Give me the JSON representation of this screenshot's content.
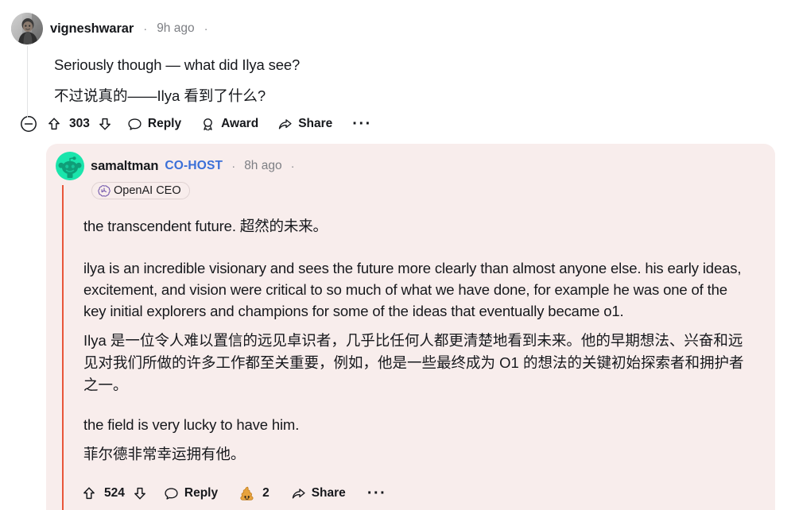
{
  "root_comment": {
    "author": "vigneshwarar",
    "timestamp": "9h ago",
    "separator": "·",
    "avatar_icon": "user-photo-avatar",
    "text_en": "Seriously though — what did Ilya see?",
    "text_zh": "不过说真的——Ilya 看到了什么?",
    "actions": {
      "collapse_icon": "minus-circle-icon",
      "upvote_icon": "upvote-arrow-icon",
      "score": "303",
      "downvote_icon": "downvote-arrow-icon",
      "reply_icon": "speech-bubble-icon",
      "reply_label": "Reply",
      "award_icon": "award-medal-icon",
      "award_label": "Award",
      "share_icon": "share-arrow-icon",
      "share_label": "Share",
      "overflow_label": "···"
    }
  },
  "reply_comment": {
    "author": "samaltman",
    "badge": "CO-HOST",
    "timestamp": "8h ago",
    "separator": "·",
    "avatar_icon": "reddit-snoo-avatar",
    "flair": {
      "icon": "openai-logo-icon",
      "label": "OpenAI CEO"
    },
    "paragraphs": [
      {
        "type": "en",
        "text": "the transcendent future.  超然的未来。"
      },
      {
        "type": "en",
        "text": "ilya is an incredible visionary and sees the future more clearly than almost anyone else. his early ideas, excitement, and vision were critical to so much of what we have done, for example he was one of the key initial explorers and champions for some of the ideas that eventually became o1."
      },
      {
        "type": "zh",
        "text": "Ilya 是一位令人难以置信的远见卓识者，几乎比任何人都更清楚地看到未来。他的早期想法、兴奋和远见对我们所做的许多工作都至关重要，例如，他是一些最终成为 O1 的想法的关键初始探索者和拥护者之一。"
      },
      {
        "type": "en",
        "text": "the field is very lucky to have him."
      },
      {
        "type": "zh",
        "text": "菲尔德非常幸运拥有他。"
      }
    ],
    "actions": {
      "upvote_icon": "upvote-arrow-icon",
      "score": "524",
      "downvote_icon": "downvote-arrow-icon",
      "reply_icon": "speech-bubble-icon",
      "reply_label": "Reply",
      "award_emoji": "🦴",
      "award_count": "2",
      "share_icon": "share-arrow-icon",
      "share_label": "Share",
      "overflow_label": "···"
    }
  },
  "colors": {
    "reply_background": "#f8edec",
    "thread_line": "#e8563a",
    "cohost_blue": "#3a6fd8",
    "snoo_teal": "#1ae5ac",
    "openai_purple": "#6b4fa8"
  }
}
